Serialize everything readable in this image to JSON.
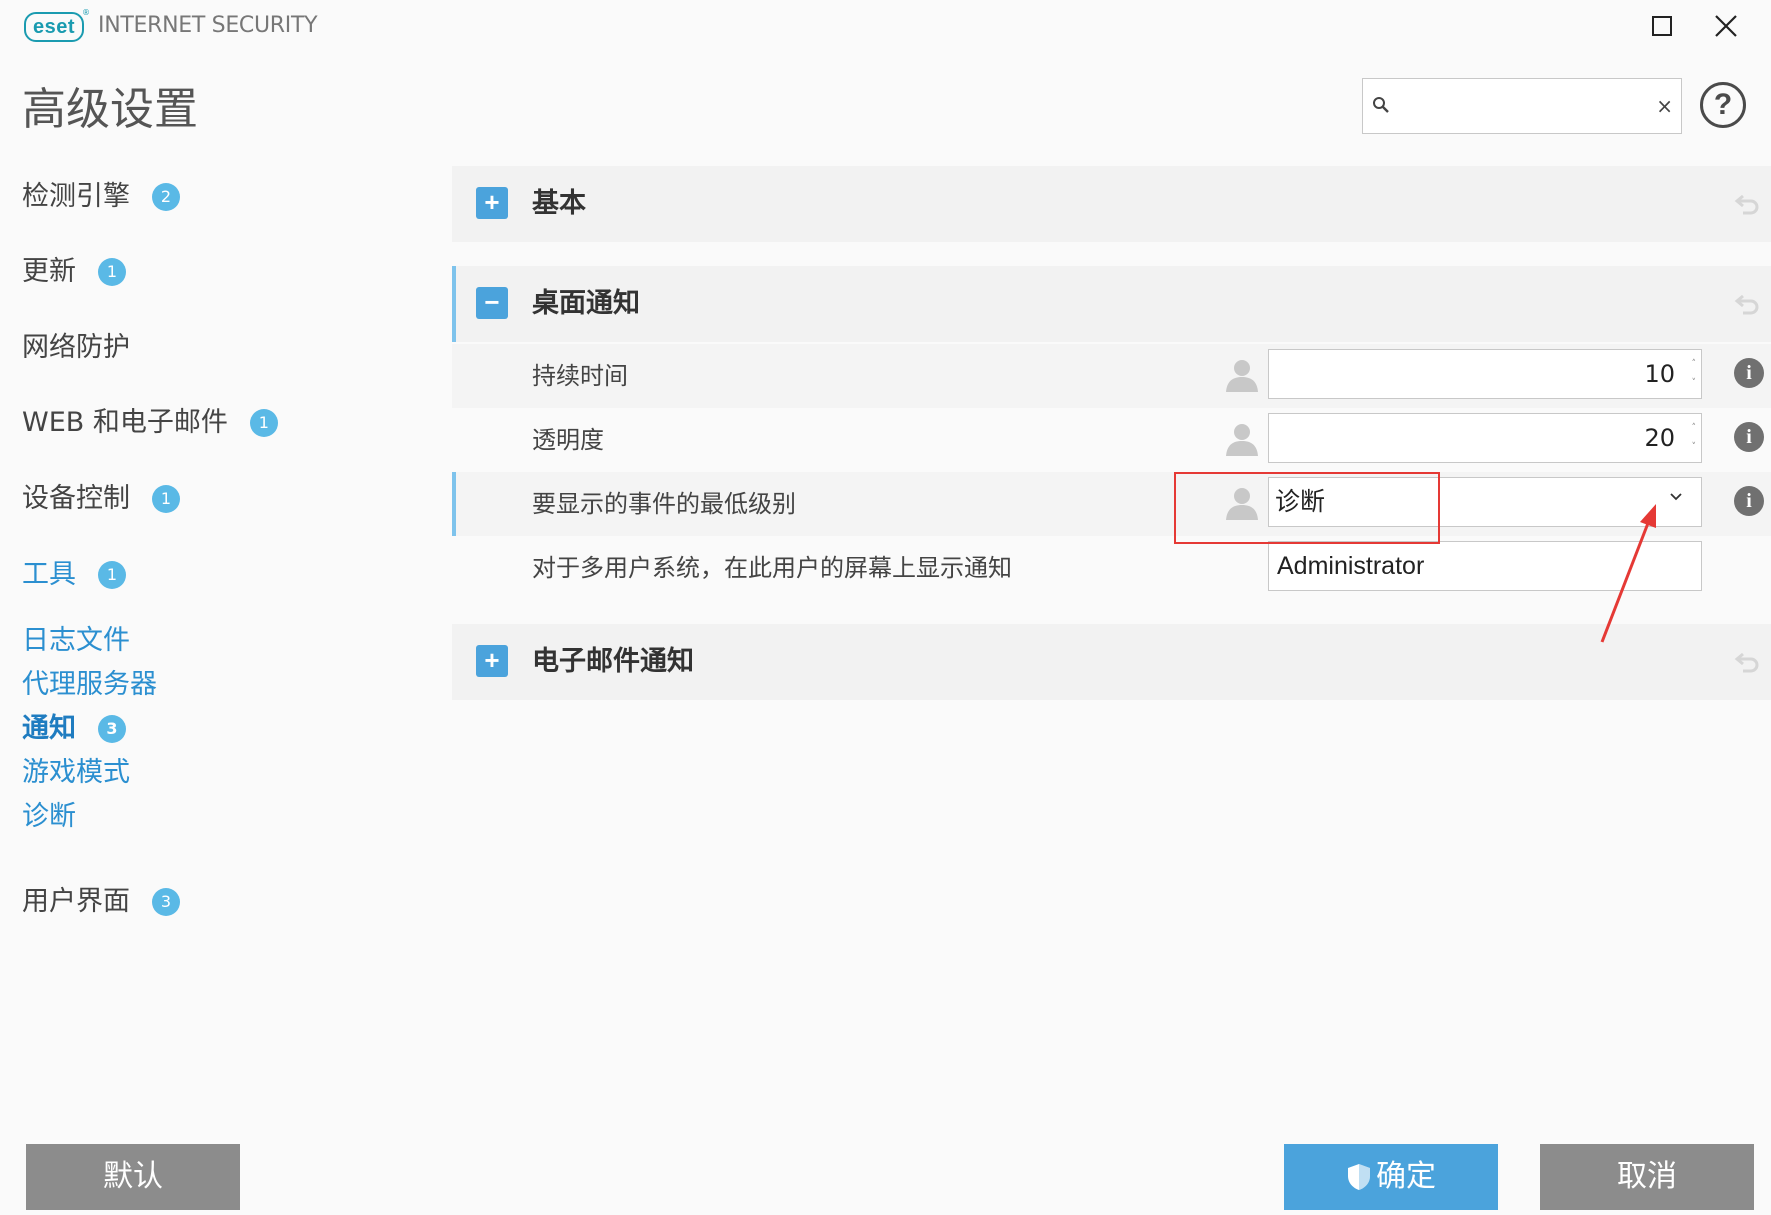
{
  "window": {
    "logo_text": "eset",
    "logo_registered": "®",
    "product_name": "INTERNET SECURITY"
  },
  "header": {
    "page_title": "高级设置",
    "search": {
      "value": "",
      "placeholder": "",
      "clear_label": "×"
    },
    "help_label": "?"
  },
  "sidebar": {
    "items": [
      {
        "label": "检测引擎",
        "badge": "2"
      },
      {
        "label": "更新",
        "badge": "1"
      },
      {
        "label": "网络防护"
      },
      {
        "label": "WEB 和电子邮件",
        "badge": "1"
      },
      {
        "label": "设备控制",
        "badge": "1"
      },
      {
        "label": "工具",
        "badge": "1"
      },
      {
        "label": "日志文件"
      },
      {
        "label": "代理服务器"
      },
      {
        "label": "通知",
        "badge": "3"
      },
      {
        "label": "游戏模式"
      },
      {
        "label": "诊断"
      },
      {
        "label": "用户界面",
        "badge": "3"
      }
    ]
  },
  "main": {
    "sections": [
      {
        "toggle": "+",
        "title": "基本",
        "expanded": false
      },
      {
        "toggle": "−",
        "title": "桌面通知",
        "expanded": true
      },
      {
        "toggle": "+",
        "title": "电子邮件通知",
        "expanded": false
      }
    ],
    "desktop_notifications": {
      "rows": [
        {
          "label": "持续时间",
          "value": "10"
        },
        {
          "label": "透明度",
          "value": "20"
        },
        {
          "label": "要显示的事件的最低级别",
          "value": "诊断"
        },
        {
          "label": "对于多用户系统，在此用户的屏幕上显示通知",
          "value": "Administrator"
        }
      ],
      "spin_up": "˄",
      "spin_down": "˅",
      "info_label": "i"
    }
  },
  "footer": {
    "default_label": "默认",
    "ok_label": "确定",
    "cancel_label": "取消"
  },
  "colors": {
    "accent": "#4ba3dc",
    "badge": "#5ab9e6",
    "annotation": "#e53935",
    "button_gray": "#8c8c8c"
  }
}
